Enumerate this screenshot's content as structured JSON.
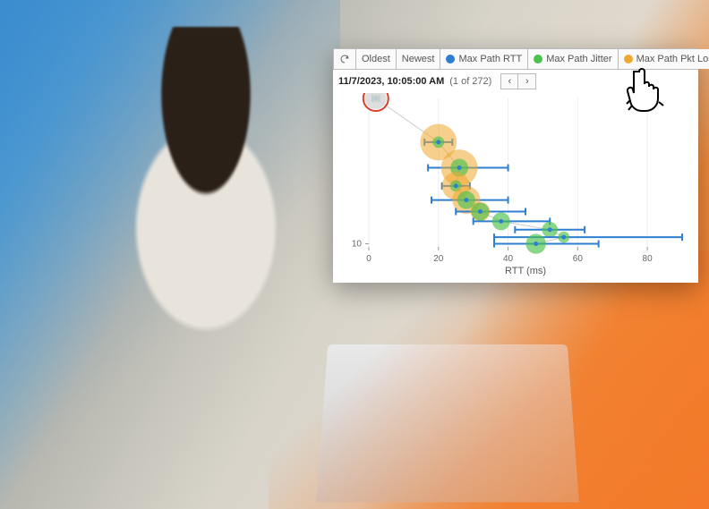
{
  "toolbar": {
    "refresh_label": "Refresh",
    "oldest_label": "Oldest",
    "newest_label": "Newest",
    "legend": [
      {
        "label": "Max Path RTT",
        "color": "#2f7fd1"
      },
      {
        "label": "Max Path Jitter",
        "color": "#4bc24b"
      },
      {
        "label": "Max Path Pkt Loss",
        "color": "#f0a830"
      }
    ]
  },
  "subbar": {
    "timestamp": "11/7/2023, 10:05:00 AM",
    "position": "(1 of 272)",
    "prev_label": "‹",
    "next_label": "›"
  },
  "chart_data": {
    "type": "scatter",
    "title": "",
    "xlabel": "RTT (ms)",
    "ylabel": "",
    "xlim": [
      0,
      90
    ],
    "ylim": [
      1,
      10.5
    ],
    "xticks": [
      0,
      20,
      40,
      60,
      80
    ],
    "yticks": [
      10
    ],
    "yscale": "log",
    "selected_index": 0,
    "hops": [
      {
        "hop": 1,
        "rtt": 2,
        "rtt_lo": 1,
        "rtt_hi": 3,
        "jitter": 0.4,
        "loss": 0
      },
      {
        "hop": 2,
        "rtt": 20,
        "rtt_lo": 16,
        "rtt_hi": 24,
        "jitter": 2,
        "loss": 9
      },
      {
        "hop": 3,
        "rtt": 26,
        "rtt_lo": 17,
        "rtt_hi": 40,
        "jitter": 5,
        "loss": 9
      },
      {
        "hop": 4,
        "rtt": 25,
        "rtt_lo": 21,
        "rtt_hi": 29,
        "jitter": 2,
        "loss": 6
      },
      {
        "hop": 5,
        "rtt": 28,
        "rtt_lo": 18,
        "rtt_hi": 40,
        "jitter": 5,
        "loss": 6
      },
      {
        "hop": 6,
        "rtt": 32,
        "rtt_lo": 25,
        "rtt_hi": 45,
        "jitter": 5,
        "loss": 3
      },
      {
        "hop": 7,
        "rtt": 38,
        "rtt_lo": 30,
        "rtt_hi": 52,
        "jitter": 5,
        "loss": 0
      },
      {
        "hop": 8,
        "rtt": 52,
        "rtt_lo": 42,
        "rtt_hi": 62,
        "jitter": 4,
        "loss": 0
      },
      {
        "hop": 9,
        "rtt": 56,
        "rtt_lo": 36,
        "rtt_hi": 90,
        "jitter": 2,
        "loss": 0
      },
      {
        "hop": 10,
        "rtt": 48,
        "rtt_lo": 36,
        "rtt_hi": 66,
        "jitter": 6,
        "loss": 0
      }
    ],
    "colors": {
      "rtt": "#2f7fd1",
      "jitter": "#4bc24b",
      "loss": "#f0a830",
      "selected_stroke": "#d8402c",
      "path": "#cccccc"
    }
  }
}
